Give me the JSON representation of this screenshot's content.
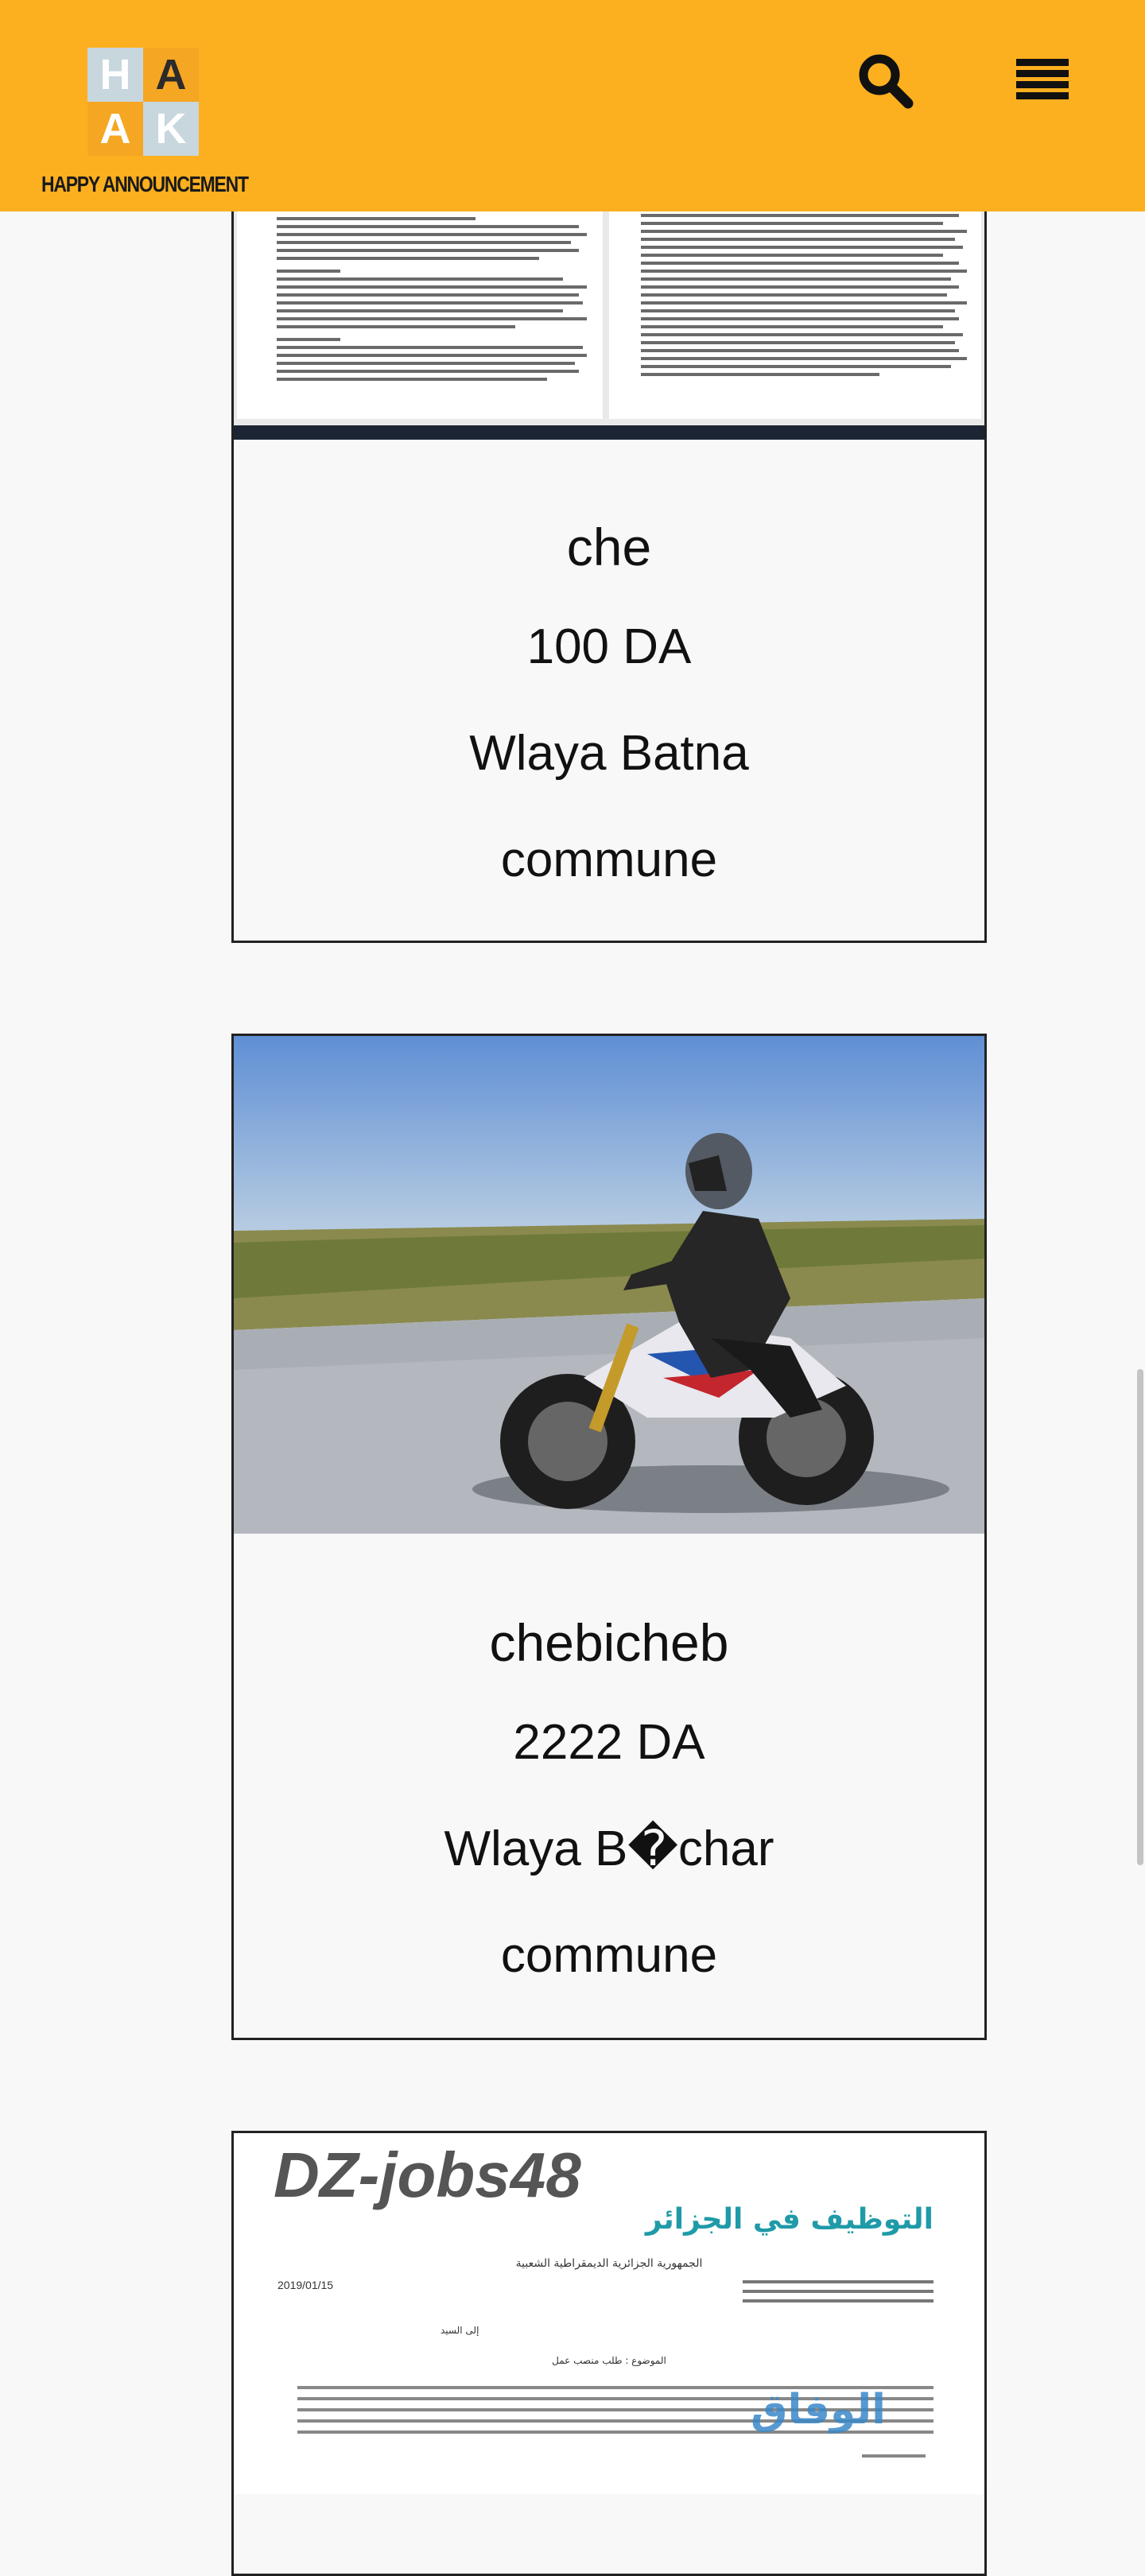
{
  "header": {
    "brand_text": "HAPPY ANNOUNCEMENT",
    "logo_letters": [
      "H",
      "A",
      "A",
      "K"
    ],
    "accent_color": "#fdb01f",
    "search_icon": "search-icon",
    "menu_icon": "menu-icon"
  },
  "listings": [
    {
      "title": "che",
      "price": "100 DA",
      "wilaya": "Wlaya Batna",
      "commune": "commune",
      "image": "document-screenshot"
    },
    {
      "title": "chebicheb",
      "price": "2222 DA",
      "wilaya": "Wlaya B�char",
      "commune": "commune",
      "image": "motorcycle-photo"
    },
    {
      "title": "",
      "price": "",
      "wilaya": "",
      "commune": "",
      "image": "job-application-document",
      "image_text": {
        "logo": "DZ-jobs48",
        "logo_arabic": "التوظيف في الجزائر",
        "watermark": "الوفاق",
        "republic": "الجمهورية الجزائرية الديمقراطية الشعبية",
        "date": "2019/01/15",
        "subject": "الموضوع : طلب منصب عمل",
        "to": "إلى السيد"
      }
    }
  ]
}
